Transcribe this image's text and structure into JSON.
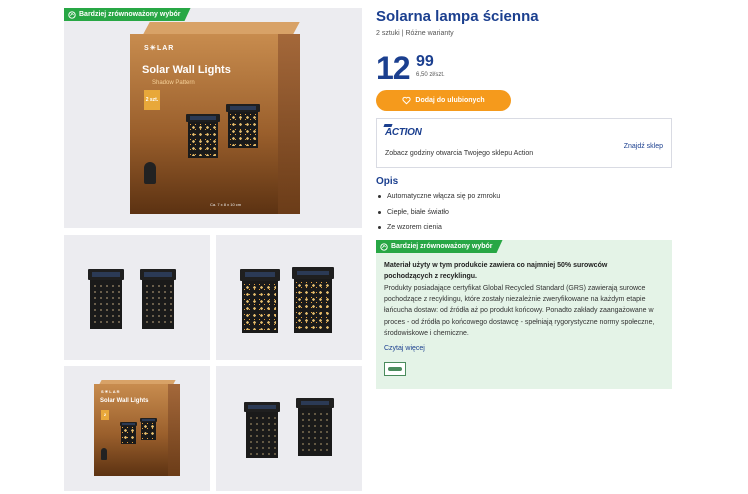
{
  "badge_label": "Bardziej zrównoważony wybór",
  "gallery": {
    "box_brand": "S☀LAR",
    "box_title": "Solar Wall Lights",
    "box_subtitle": "Shadow Pattern",
    "box_tag": "2 szt.",
    "box_small_tag": "2",
    "box_led": "LED",
    "box_dims": "Ca. 7 x 8 x 10 cm"
  },
  "product": {
    "title": "Solarna lampa ścienna",
    "variants": "2 sztuki | Różne warianty",
    "price_int": "12",
    "price_dec": "99",
    "unit_price": "6,50 zł/szt.",
    "fav_label": "Dodaj do ulubionych"
  },
  "store": {
    "logo": "ACTION",
    "text": "Zobacz godziny otwarcia Twojego sklepu Action",
    "link": "Znajdź sklep"
  },
  "description": {
    "heading": "Opis",
    "bullets": [
      "Automatyczne włącza się po zmroku",
      "Ciepłe, białe światło",
      "Ze wzorem cienia"
    ]
  },
  "sustainability": {
    "bold_text": "Materiał użyty w tym produkcie zawiera co najmniej 50% surowców pochodzących z recyklingu.",
    "body_text": "Produkty posiadające certyfikat Global Recycled Standard (GRS) zawierają surowce pochodzące z recyklingu, które zostały niezależnie zweryfikowane na każdym etapie łańcucha dostaw: od źródła aż po produkt końcowy. Ponadto zakłady zaangażowane w proces - od źródła po końcowego dostawcę - spełniają rygorystyczne normy społeczne, środowiskowe i chemiczne.",
    "read_more": "Czytaj więcej"
  },
  "colors": {
    "brand_blue": "#1b3f8f",
    "badge_green": "#28a745",
    "button_orange": "#f59a1c",
    "eco_bg": "#e4f3e7"
  }
}
